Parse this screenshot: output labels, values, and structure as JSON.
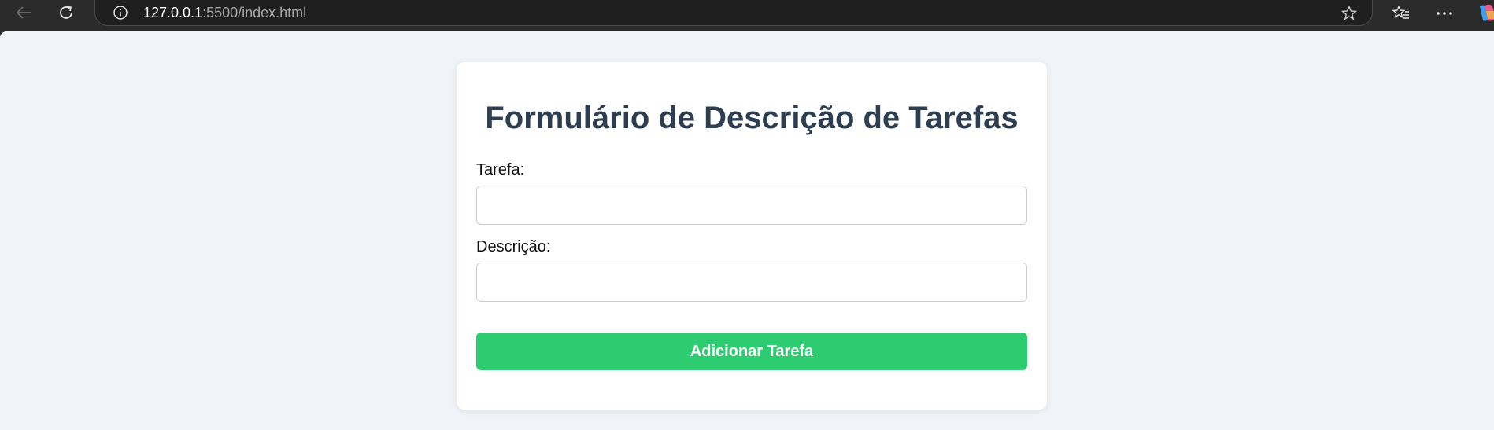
{
  "browser": {
    "url_host": "127.0.0.1",
    "url_rest": ":5500/index.html",
    "icons": [
      "back-arrow-icon",
      "refresh-icon",
      "info-icon",
      "star-icon",
      "favorites-icon",
      "more-icon",
      "copilot-icon"
    ]
  },
  "form": {
    "title": "Formulário de Descrição de Tarefas",
    "task_label": "Tarefa:",
    "task_value": "",
    "description_label": "Descrição:",
    "description_value": "",
    "submit_label": "Adicionar Tarefa"
  },
  "colors": {
    "page_background": "#f0f3f7",
    "card_background": "#ffffff",
    "title_color": "#2c3e50",
    "button_color": "#2ecc71",
    "button_text": "#ffffff",
    "browser_chrome": "#2b2b2b"
  }
}
